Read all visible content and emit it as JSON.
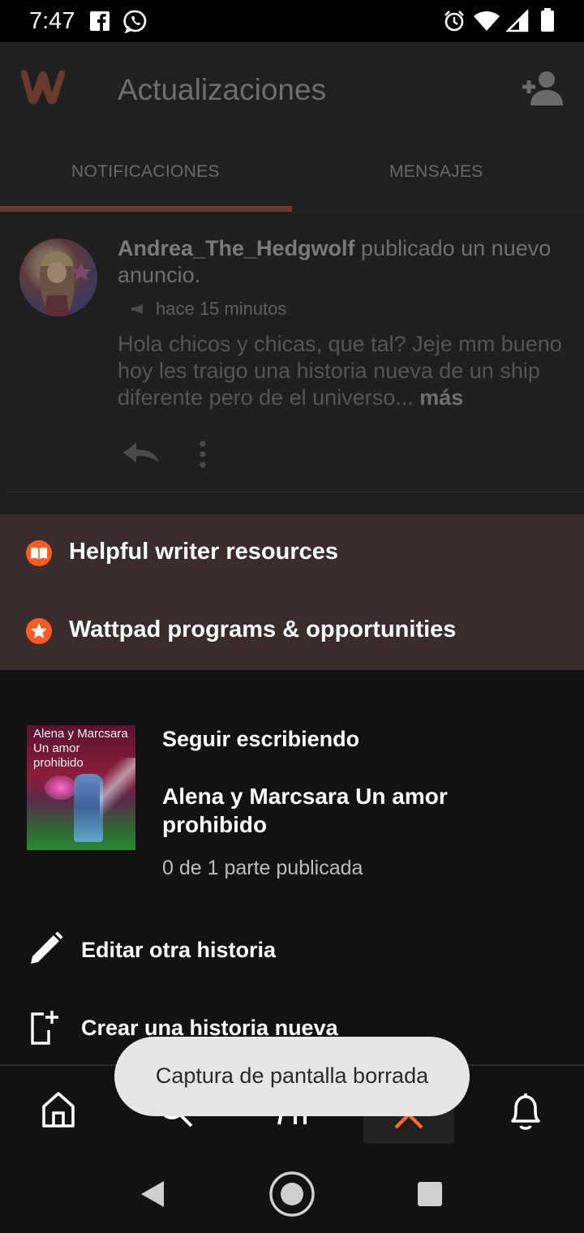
{
  "status_bar": {
    "time": "7:47"
  },
  "app_bar": {
    "title": "Actualizaciones"
  },
  "tabs": [
    {
      "label": "NOTIFICACIONES",
      "selected": true
    },
    {
      "label": "MENSAJES",
      "selected": false
    }
  ],
  "notification": {
    "username": "Andrea_The_Hedgwolf",
    "action_text": " publicado un nuevo anuncio.",
    "time": "hace 15 minutos",
    "body": "Hola chicos y chicas, que tal? Jeje mm bueno hoy les traigo una historia nueva de un ship diferente pero de el universo...",
    "more_label": "más"
  },
  "promos": [
    {
      "label": "Helpful writer resources",
      "icon": "book-icon"
    },
    {
      "label": "Wattpad programs & opportunities",
      "icon": "star-icon"
    }
  ],
  "continue_writing": {
    "heading": "Seguir escribiendo",
    "cover_text": "Alena y Marcsara Un amor prohibido",
    "story_title": "Alena y Marcsara Un amor prohibido",
    "meta": "0 de 1 parte publicada"
  },
  "actions": [
    {
      "label": "Editar otra historia",
      "icon": "pencil-icon"
    },
    {
      "label": "Crear una historia nueva",
      "icon": "new-story-icon"
    }
  ],
  "toast": {
    "text": "Captura de pantalla borrada"
  },
  "colors": {
    "accent": "#ff5a24",
    "promo_bg": "#3a2c2a",
    "sheet_bg": "#121212"
  }
}
